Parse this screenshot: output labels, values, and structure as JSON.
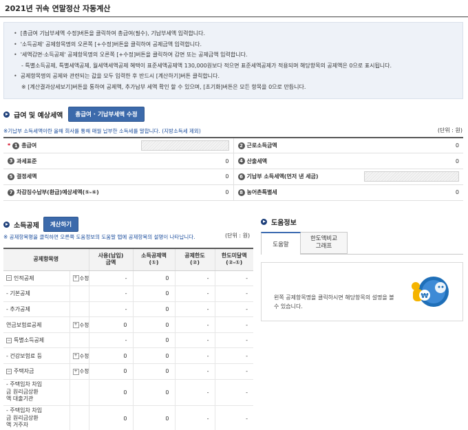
{
  "page": {
    "title": "2021년 귀속 연말정산 자동계산"
  },
  "guide": {
    "items": [
      {
        "type": "b",
        "text": "[총급여 기납부세액 수정]버튼을 클릭하여 총급여(필수), 기납부세액 입력합니다."
      },
      {
        "type": "b",
        "text": "'소득공제' 공제항목명의 오른쪽 [+수정]버튼을 클릭하여 공제금액 입력합니다."
      },
      {
        "type": "b",
        "text": "'세액감면·소득공제' 공제항목명의 오른쪽 [+수정]버튼을 클릭하여 감면 또는 공제금액 입력합니다."
      },
      {
        "type": "sub",
        "text": "- 특별소득공제, 특별세액공제, 월세액세액공제 혜택이 표준세액공제액 130,000원보다 적으면 표준세액공제가 적용되며 해당항목의 공제액은 0으로 표시됩니다."
      },
      {
        "type": "b",
        "text": "공제항목명의 공제와 관련되는 값을 모두 입력한 후 반드시 [계산하기]버튼 클릭합니다."
      },
      {
        "type": "sub2",
        "text": "※ [계산결과상세보기]버튼을 통하여 공제액, 추가납부 세액 확인 할 수 있으며, [초기화]버튼은 모든 항목을 0으로 만듭니다."
      }
    ]
  },
  "salary": {
    "title": "급여 및 예상세액",
    "edit_button": "총급여 · 기납부세액 수정",
    "note": "※기납부 소득세액이란 올해 회사를 통해 매월 납부한 소득세를 말합니다. (지방소득세 제외)",
    "unit": "(단위 : 원)",
    "rows": [
      {
        "l_req": "*",
        "l_num": "1",
        "l_label": "총급여",
        "l_hatch": true,
        "l_val": "",
        "r_num": "2",
        "r_label": "근로소득금액",
        "r_hatch": false,
        "r_val": "0"
      },
      {
        "l_req": "",
        "l_num": "3",
        "l_label": "과세표준",
        "l_hatch": false,
        "l_val": "0",
        "r_num": "4",
        "r_label": "산출세액",
        "r_hatch": false,
        "r_val": "0"
      },
      {
        "l_req": "",
        "l_num": "5",
        "l_label": "결정세액",
        "l_hatch": false,
        "l_val": "0",
        "r_num": "6",
        "r_label": "기납부 소득세액(먼저 낸 세금)",
        "r_hatch": true,
        "r_val": ""
      },
      {
        "l_req": "",
        "l_num": "7",
        "l_label": "차감징수납부(환급)예상세액(⑤-⑥)",
        "l_hatch": false,
        "l_val": "0",
        "r_num": "8",
        "r_label": "농어촌특별세",
        "r_hatch": false,
        "r_val": "0"
      }
    ]
  },
  "deduction": {
    "title": "소득공제",
    "calc_button": "계산하기",
    "note": "※ 공제항목명을 클릭하면 오른쪽 도움정보의 도움말 탭에 공제항목의 설명이 나타납니다.",
    "unit": "(단위 : 원)",
    "headers": [
      "공제항목명",
      "",
      "사용(납입)\n금액",
      "소득공제액\n(①)",
      "공제한도\n(②)",
      "한도미달액\n(②-①)"
    ],
    "rows": [
      {
        "level": 1,
        "toggle": "−",
        "name": "인적공제",
        "edit": "수정",
        "used": "-",
        "amount": "0",
        "limit": "-",
        "under": "-",
        "tall": false
      },
      {
        "level": 2,
        "toggle": "",
        "name": "- 기본공제",
        "edit": "",
        "used": "-",
        "amount": "0",
        "limit": "-",
        "under": "-",
        "tall": false
      },
      {
        "level": 2,
        "toggle": "",
        "name": "- 추가공제",
        "edit": "",
        "used": "-",
        "amount": "0",
        "limit": "-",
        "under": "-",
        "tall": false
      },
      {
        "level": 1,
        "toggle": "",
        "name": "연금보험료공제",
        "edit": "수정",
        "used": "0",
        "amount": "0",
        "limit": "-",
        "under": "-",
        "tall": false
      },
      {
        "level": 1,
        "toggle": "−",
        "name": "특별소득공제",
        "edit": "",
        "used": "-",
        "amount": "0",
        "limit": "-",
        "under": "-",
        "tall": false
      },
      {
        "level": 2,
        "toggle": "",
        "name": "- 건강보험료 등",
        "edit": "수정",
        "used": "0",
        "amount": "0",
        "limit": "-",
        "under": "-",
        "tall": false
      },
      {
        "level": 2,
        "toggle": "−",
        "name": "주택자금",
        "edit": "수정",
        "used": "0",
        "amount": "0",
        "limit": "-",
        "under": "-",
        "tall": false
      },
      {
        "level": 3,
        "toggle": "",
        "name": "- 주택임차 차입\n금 원리금상환\n액 대출기관",
        "edit": "",
        "used": "0",
        "amount": "0",
        "limit": "-",
        "under": "-",
        "tall": true
      },
      {
        "level": 3,
        "toggle": "",
        "name": "- 주택임차 차입\n금 원리금상환\n액 거주자",
        "edit": "",
        "used": "0",
        "amount": "0",
        "limit": "-",
        "under": "-",
        "tall": true
      }
    ]
  },
  "help": {
    "title": "도움정보",
    "tabs": [
      "도움말",
      "한도액비교\n그래프"
    ],
    "text": "왼쪽 공제항목명을 클릭하시면 해당항목의 설명을 볼 수 있습니다."
  },
  "colors": {
    "accent": "#3c6aab",
    "guide_bg": "#eef2f8",
    "required": "#d0021b",
    "note": "#1a4c9c"
  },
  "icons": [
    "arrow-circle-icon",
    "won-coin-icon"
  ]
}
